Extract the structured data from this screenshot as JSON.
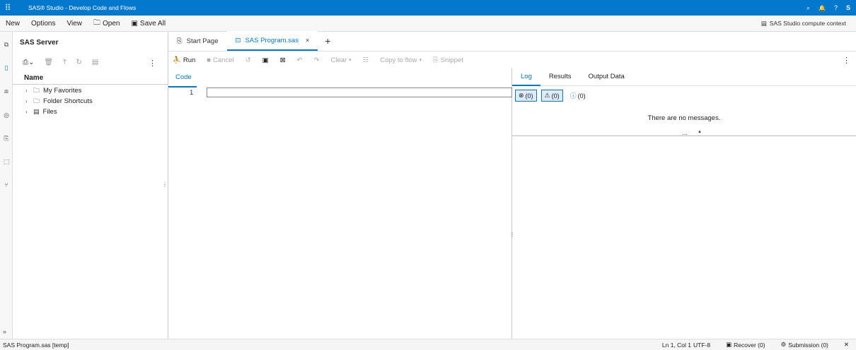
{
  "app": {
    "title": "SAS® Studio - Develop Code and Flows",
    "user_initial": "S"
  },
  "titlebar_icons": {
    "apps": "⠿",
    "search": "⌕",
    "bell": "🔔",
    "help": "?"
  },
  "menu": {
    "new": "New",
    "options": "Options",
    "view": "View",
    "open": "Open",
    "save_all": "Save All",
    "context": "SAS Studio compute context"
  },
  "server": {
    "title": "SAS Server",
    "column": "Name",
    "items": [
      {
        "label": "My Favorites"
      },
      {
        "label": "Folder Shortcuts"
      },
      {
        "label": "Files"
      }
    ]
  },
  "tabs": {
    "start": "Start Page",
    "program": "SAS Program.sas",
    "close": "×",
    "add": "+"
  },
  "toolbar": {
    "run": "Run",
    "cancel": "Cancel",
    "clear": "Clear",
    "copy_to_flow": "Copy to flow",
    "snippet": "Snippet"
  },
  "code": {
    "tab": "Code",
    "line_number": "1"
  },
  "log": {
    "tabs": [
      "Log",
      "Results",
      "Output Data"
    ],
    "errors": "(0)",
    "warnings": "(0)",
    "notes": "(0)",
    "message": "There are no messages."
  },
  "status": {
    "file": "SAS Program.sas [temp]",
    "position": "Ln 1, Col 1",
    "encoding": "UTF-8",
    "recover": "Recover (0)",
    "submission": "Submission (0)"
  },
  "colors": {
    "brand": "#0378cd",
    "accent_bg": "#dceafa"
  }
}
